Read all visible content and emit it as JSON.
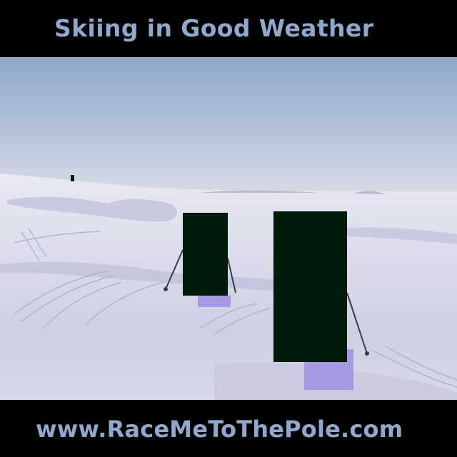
{
  "header": {
    "title": "Skiing in Good Weather"
  },
  "footer": {
    "url": "www.RaceMeToThePole.com"
  },
  "colors": {
    "text": "#8fa8cc",
    "background": "#000000",
    "figure_block": "#001a0c",
    "ski_block": "#a69be0"
  }
}
